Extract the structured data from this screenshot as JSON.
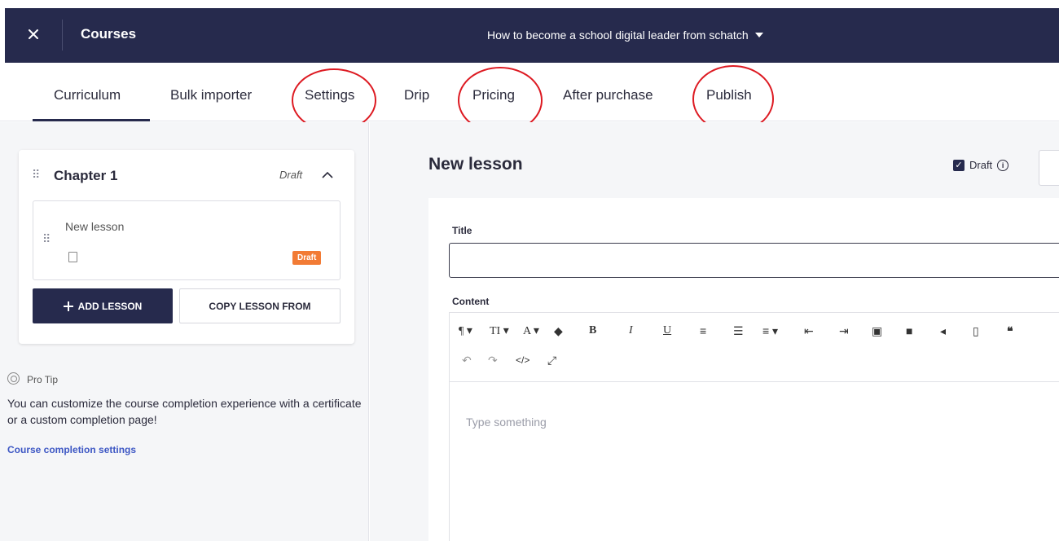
{
  "header": {
    "title": "Courses",
    "course_name": "How to become a school digital leader from schatch"
  },
  "tabs": [
    {
      "label": "Curriculum",
      "active": true
    },
    {
      "label": "Bulk importer"
    },
    {
      "label": "Settings"
    },
    {
      "label": "Drip"
    },
    {
      "label": "Pricing"
    },
    {
      "label": "After purchase"
    },
    {
      "label": "Publish"
    }
  ],
  "chapter": {
    "title": "Chapter 1",
    "status": "Draft",
    "lessons": [
      {
        "name": "New lesson",
        "badge": "Draft"
      }
    ],
    "add_lesson_label": "ADD LESSON",
    "copy_lesson_label": "COPY LESSON FROM"
  },
  "pro_tip": {
    "title": "Pro Tip",
    "text": "You can customize the course completion experience with a certificate or a custom completion page!",
    "link": "Course completion settings"
  },
  "lesson_editor": {
    "heading": "New lesson",
    "draft_label": "Draft",
    "draft_checked": true,
    "title_label": "Title",
    "title_value": "",
    "content_label": "Content",
    "content_placeholder": "Type something"
  },
  "colors": {
    "header_bg": "#262a4d",
    "badge_orange": "#f27b35",
    "annotation_red": "#dd1a22",
    "link_blue": "#3d57c4"
  }
}
